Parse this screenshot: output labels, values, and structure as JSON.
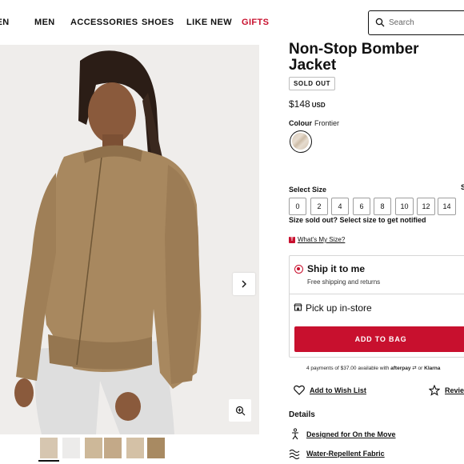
{
  "nav": {
    "items": [
      {
        "label": "MEN",
        "variant": "partial"
      },
      {
        "label": "MEN"
      },
      {
        "label": "ACCESSORIES"
      },
      {
        "label": "SHOES"
      },
      {
        "label": "LIKE NEW"
      },
      {
        "label": "GIFTS",
        "color": "#c8102e"
      }
    ],
    "search_placeholder": "Search"
  },
  "product": {
    "title": "Non-Stop Bomber Jacket",
    "status_badge": "SOLD OUT",
    "price": "$148",
    "currency": "USD",
    "colour_label": "Colour",
    "colour_value": "Frontier",
    "sizes_label": "Select Size",
    "sizes": [
      "0",
      "2",
      "4",
      "6",
      "8",
      "10",
      "12",
      "14"
    ],
    "sold_out_note": "Size sold out? Select size to get notified",
    "size_guide_link": "What's My Size?",
    "size_guide_badge": "T"
  },
  "fulfillment": {
    "ship_title": "Ship it to me",
    "ship_subtitle": "Free shipping and returns",
    "pickup_title": "Pick up in-store",
    "add_to_bag": "ADD TO BAG"
  },
  "payments": {
    "text": "4 payments of $37.00 available with",
    "afterpay": "afterpay",
    "or": "or",
    "klarna": "Klarna"
  },
  "actions": {
    "wishlist": "Add to Wish List",
    "reviews": "Review"
  },
  "details": {
    "heading": "Details",
    "items": [
      {
        "label": "Designed for On the Move",
        "icon": "person-running-icon"
      },
      {
        "label": "Water-Repellent Fabric",
        "icon": "water-waves-icon"
      }
    ]
  },
  "colors": {
    "accent_red": "#c8102e",
    "jacket_tan": "#a8885f"
  }
}
